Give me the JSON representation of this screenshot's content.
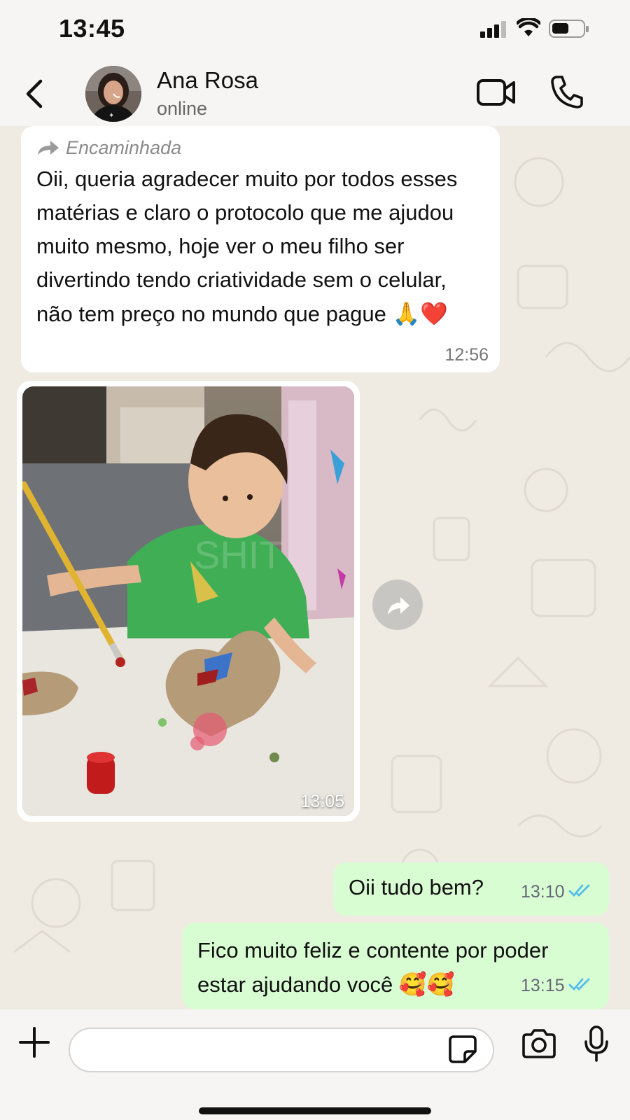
{
  "status_bar": {
    "time": "13:45"
  },
  "header": {
    "back_icon": "chevron-left-icon",
    "contact_name": "Ana Rosa",
    "contact_status": "online",
    "video_icon": "video-camera-icon",
    "call_icon": "phone-icon"
  },
  "messages": [
    {
      "direction": "incoming",
      "forwarded_label": "Encaminhada",
      "text": "Oii, queria agradecer muito por todos esses matérias e claro o protocolo que me ajudou muito mesmo, hoje ver o meu filho ser divertindo tendo criatividade sem o celular, não tem preço no mundo que pague",
      "emoji": "🙏❤️",
      "time": "12:56"
    },
    {
      "direction": "incoming",
      "type": "image",
      "time": "13:05"
    },
    {
      "direction": "outgoing",
      "text": "Oii tudo bem?",
      "time": "13:10",
      "status": "read"
    },
    {
      "direction": "outgoing",
      "text": "Fico muito feliz e contente por poder estar ajudando você",
      "emoji": "🥰🥰",
      "time": "13:15",
      "status": "read"
    }
  ],
  "input_bar": {
    "plus_icon": "plus-icon",
    "input_value": "",
    "sticker_icon": "sticker-icon",
    "camera_icon": "camera-icon",
    "mic_icon": "microphone-icon"
  },
  "colors": {
    "chat_background": "#efeae2",
    "incoming_bubble": "#ffffff",
    "outgoing_bubble": "#d9fdd3",
    "read_ticks": "#53bdeb"
  }
}
